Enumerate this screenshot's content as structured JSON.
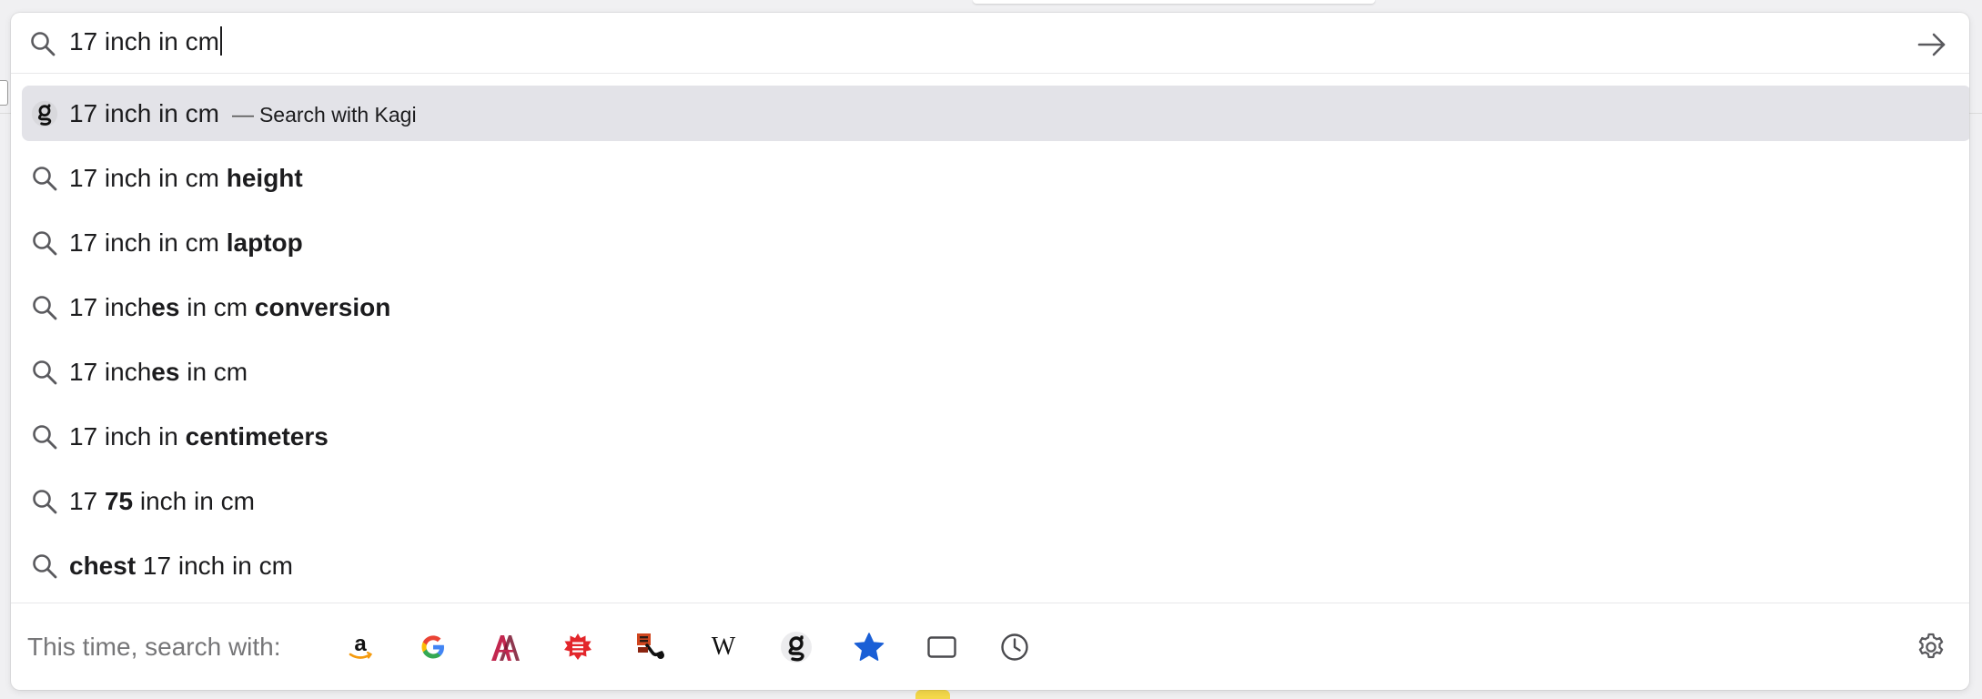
{
  "urlbar": {
    "value": "17 inch in cm"
  },
  "results": [
    {
      "segments": [
        {
          "text": "17 inch in cm",
          "bold": false
        }
      ],
      "separator": "—",
      "hint": "Search with Kagi",
      "icon": "kagi-icon",
      "selected": true
    },
    {
      "segments": [
        {
          "text": "17 inch in cm ",
          "bold": false
        },
        {
          "text": "height",
          "bold": true
        }
      ],
      "icon": "search-icon"
    },
    {
      "segments": [
        {
          "text": "17 inch in cm ",
          "bold": false
        },
        {
          "text": "laptop",
          "bold": true
        }
      ],
      "icon": "search-icon"
    },
    {
      "segments": [
        {
          "text": "17 inch",
          "bold": false
        },
        {
          "text": "es",
          "bold": true
        },
        {
          "text": " in cm ",
          "bold": false
        },
        {
          "text": "conversion",
          "bold": true
        }
      ],
      "icon": "search-icon"
    },
    {
      "segments": [
        {
          "text": "17 inch",
          "bold": false
        },
        {
          "text": "es",
          "bold": true
        },
        {
          "text": " in cm",
          "bold": false
        }
      ],
      "icon": "search-icon"
    },
    {
      "segments": [
        {
          "text": "17 inch in ",
          "bold": false
        },
        {
          "text": "centimeters",
          "bold": true
        }
      ],
      "icon": "search-icon"
    },
    {
      "segments": [
        {
          "text": "17 ",
          "bold": false
        },
        {
          "text": "75",
          "bold": true
        },
        {
          "text": " inch in cm",
          "bold": false
        }
      ],
      "icon": "search-icon"
    },
    {
      "segments": [
        {
          "text": "chest",
          "bold": true
        },
        {
          "text": " 17 inch in cm",
          "bold": false
        }
      ],
      "icon": "search-icon"
    }
  ],
  "footer": {
    "label": "This time, search with:",
    "engines": [
      {
        "name": "amazon-icon"
      },
      {
        "name": "google-icon"
      },
      {
        "name": "arch-wiki-icon"
      },
      {
        "name": "red-badge-icon"
      },
      {
        "name": "tools-icon"
      },
      {
        "name": "wikipedia-icon"
      },
      {
        "name": "kagi-icon"
      },
      {
        "name": "bookmarks-star-icon"
      },
      {
        "name": "tabs-icon"
      },
      {
        "name": "history-clock-icon"
      }
    ],
    "settings_icon": "gear-icon"
  },
  "colors": {
    "selected_row": "#e3e3e8",
    "bookmark_star": "#1a5fd6",
    "footer_label": "#767678"
  }
}
